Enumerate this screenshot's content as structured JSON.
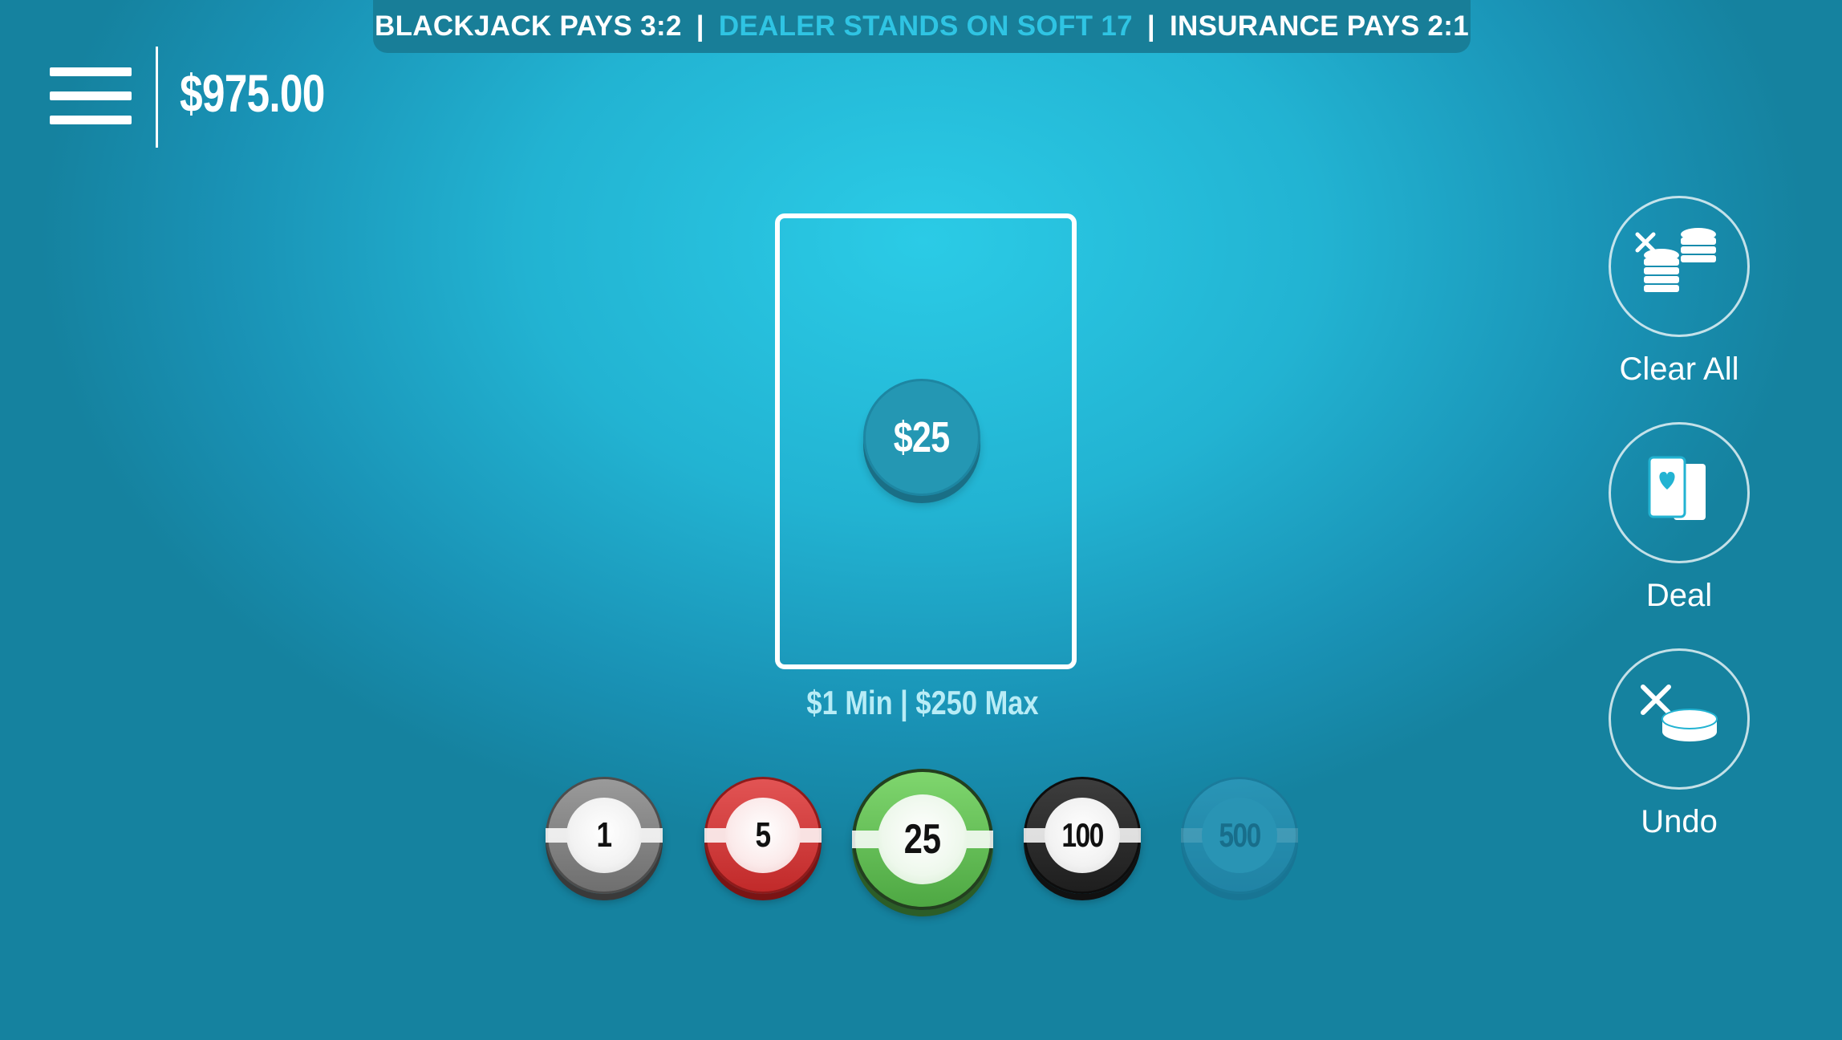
{
  "rules": {
    "blackjack": "BLACKJACK PAYS 3:2",
    "separator": "|",
    "dealer": "DEALER STANDS ON SOFT 17",
    "insurance": "INSURANCE PAYS 2:1"
  },
  "balance": "$975.00",
  "bet": {
    "amount": "$25",
    "limits": "$1 Min | $250 Max"
  },
  "chips": [
    {
      "value": "1",
      "color": "#8a8a8a"
    },
    {
      "value": "5",
      "color": "#d43b3b"
    },
    {
      "value": "25",
      "color": "#65c257",
      "selected": true
    },
    {
      "value": "100",
      "color": "#2a2a2a"
    },
    {
      "value": "500",
      "color": "#3aa3c6",
      "disabled": true
    }
  ],
  "controls": {
    "clear_all": "Clear All",
    "deal": "Deal",
    "undo": "Undo"
  },
  "icons": {
    "menu": "hamburger-menu-icon",
    "clear_all": "clear-chips-icon",
    "deal": "deal-cards-icon",
    "undo": "undo-chip-icon"
  },
  "colors": {
    "felt": "#22b3d2",
    "banner": "#187e98",
    "accent": "#2fc4e3"
  }
}
